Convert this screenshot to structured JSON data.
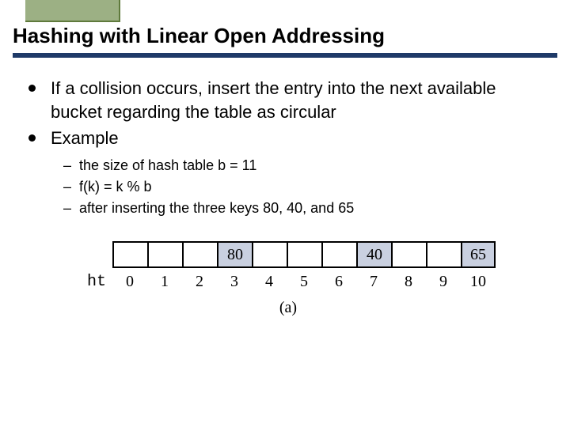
{
  "title": "Hashing with Linear Open Addressing",
  "bullets": {
    "b1": "If a collision occurs, insert the entry into the next available bucket regarding the table as circular",
    "b2": "Example"
  },
  "sub": [
    "the size of hash table b = 11",
    "f(k) = k % b",
    "after inserting the three keys 80, 40, and 65"
  ],
  "table": {
    "label": "ht",
    "cells": [
      "",
      "",
      "",
      "80",
      "",
      "",
      "",
      "40",
      "",
      "",
      "65"
    ],
    "filled": [
      false,
      false,
      false,
      true,
      false,
      false,
      false,
      true,
      false,
      false,
      true
    ],
    "indices": [
      "0",
      "1",
      "2",
      "3",
      "4",
      "5",
      "6",
      "7",
      "8",
      "9",
      "10"
    ],
    "caption": "(a)"
  }
}
